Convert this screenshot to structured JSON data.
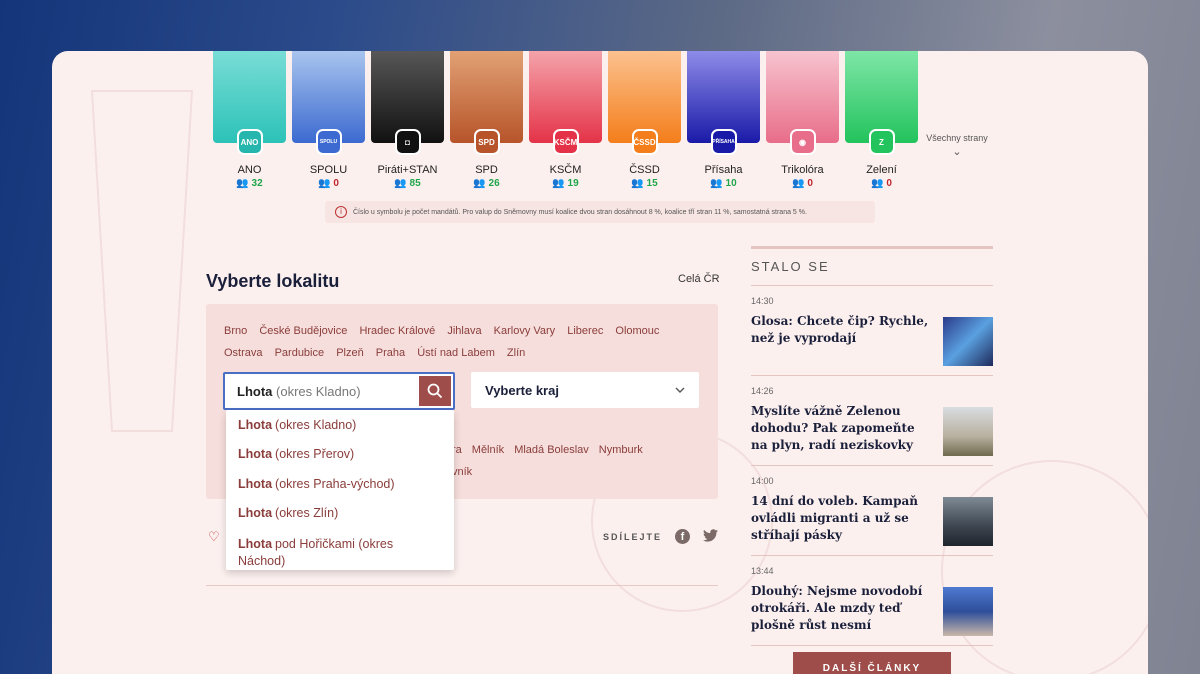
{
  "parties": [
    {
      "name": "ANO",
      "seats": "32",
      "logo": "ANO",
      "color_top": "#79ddd6",
      "color_bottom": "#2cc2b8",
      "seat_color": "#1fa64a",
      "logo_bg": "#26b6ae"
    },
    {
      "name": "SPOLU",
      "seats": "0",
      "logo": "SPOLU",
      "color_top": "#a8c4ee",
      "color_bottom": "#3c6ad0",
      "seat_color": "#c0282d",
      "logo_bg": "#3c6ad0"
    },
    {
      "name": "Piráti+STAN",
      "seats": "85",
      "logo": "◘",
      "color_top": "#575757",
      "color_bottom": "#111111",
      "seat_color": "#1fa64a",
      "logo_bg": "#111111"
    },
    {
      "name": "SPD",
      "seats": "26",
      "logo": "SPD",
      "color_top": "#e1a174",
      "color_bottom": "#b7542a",
      "seat_color": "#1fa64a",
      "logo_bg": "#b7542a"
    },
    {
      "name": "KSČM",
      "seats": "19",
      "logo": "KSČM",
      "color_top": "#f4a3aa",
      "color_bottom": "#e43348",
      "seat_color": "#1fa64a",
      "logo_bg": "#e43348"
    },
    {
      "name": "ČSSD",
      "seats": "15",
      "logo": "ČSSD",
      "color_top": "#fcc18f",
      "color_bottom": "#f47e1b",
      "seat_color": "#1fa64a",
      "logo_bg": "#f47e1b"
    },
    {
      "name": "Přísaha",
      "seats": "10",
      "logo": "PŘÍSAHA",
      "color_top": "#8e8ce8",
      "color_bottom": "#1a1aa8",
      "seat_color": "#1fa64a",
      "logo_bg": "#1a1aa8"
    },
    {
      "name": "Trikolóra",
      "seats": "0",
      "logo": "◉",
      "color_top": "#f7c4cf",
      "color_bottom": "#e86d8a",
      "seat_color": "#c0282d",
      "logo_bg": "#e86d8a"
    },
    {
      "name": "Zelení",
      "seats": "0",
      "logo": "Z",
      "color_top": "#7fe6a7",
      "color_bottom": "#23c35d",
      "seat_color": "#c0282d",
      "logo_bg": "#23c35d"
    }
  ],
  "all_parties_label": "Všechny strany",
  "note_text": "Číslo u symbolu  je počet mandátů. Pro valup do Sněmovny musí koalice dvou stran dosáhnout 8 %, koalice tří stran 11 %, samostatná strana 5 %.",
  "location": {
    "title": "Vyberte lokalitu",
    "whole_country": "Celá ČR",
    "cities": [
      "Brno",
      "České Budějovice",
      "Hradec Králové",
      "Jihlava",
      "Karlovy Vary",
      "Liberec",
      "Olomouc",
      "Ostrava",
      "Pardubice",
      "Plzeň",
      "Praha",
      "Ústí nad Labem",
      "Zlín"
    ],
    "search_value_bold": "Lhota",
    "search_value_rest": "(okres Kladno)",
    "region_placeholder": "Vyberte kraj",
    "more_cities": [
      "ra",
      "Mělník",
      "Mladá Boleslav",
      "Nymburk"
    ],
    "more_cities_2": "vník"
  },
  "dropdown": [
    {
      "bold": "Lhota",
      "rest": "(okres Kladno)"
    },
    {
      "bold": "Lhota",
      "rest": "(okres Přerov)"
    },
    {
      "bold": "Lhota",
      "rest": "(okres Praha-východ)"
    },
    {
      "bold": "Lhota",
      "rest": "(okres Zlín)"
    },
    {
      "bold": "Lhota",
      "rest": "pod Hořičkami (okres Náchod)"
    }
  ],
  "share_label": "SDÍLEJTE",
  "sidebar": {
    "heading": "STALO SE",
    "news": [
      {
        "time": "14:30",
        "title": "Glosa: Chcete čip? Rychle, než je vyprodají"
      },
      {
        "time": "14:26",
        "title": "Myslíte vážně Zelenou dohodu? Pak zapomeňte na plyn, radí neziskovky"
      },
      {
        "time": "14:00",
        "title": "14 dní do voleb. Kampaň ovládli migranti a už se stříhají pásky"
      },
      {
        "time": "13:44",
        "title": "Dlouhý: Nejsme novodobí otrokáři. Ale mzdy teď plošně růst nesmí"
      }
    ],
    "more_button": "DALŠÍ ČLÁNKY"
  }
}
